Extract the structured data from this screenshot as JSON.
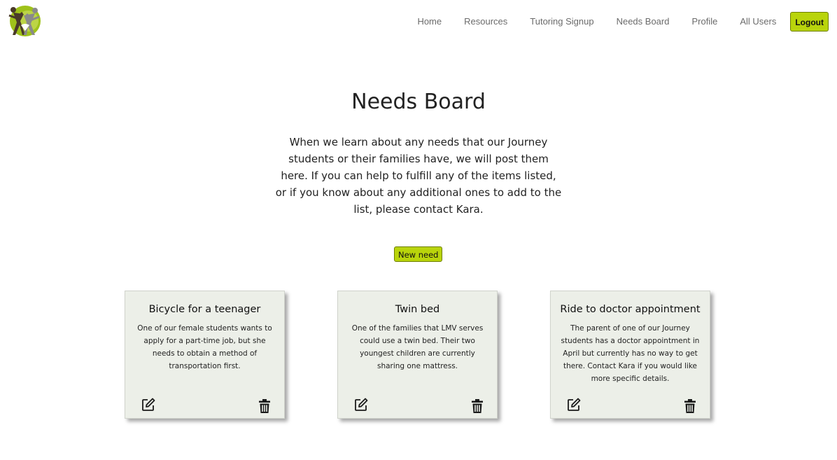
{
  "nav": {
    "items": [
      "Home",
      "Resources",
      "Tutoring Signup",
      "Needs Board",
      "Profile",
      "All Users"
    ],
    "logout_label": "Logout"
  },
  "page": {
    "title": "Needs Board",
    "intro": "When we learn about any needs that our Journey students or their families have, we will post them here. If you can help to fulfill any of the items listed, or if you know about any additional ones to add to the list, please contact Kara.",
    "new_need_label": "New need"
  },
  "needs": [
    {
      "title": "Bicycle for a teenager",
      "description": "One of our female students wants to apply for a part-time job, but she needs to obtain a method of transportation first."
    },
    {
      "title": "Twin bed",
      "description": "One of the families that LMV serves could use a twin bed. Their two youngest children are currently sharing one mattress."
    },
    {
      "title": "Ride to doctor appointment",
      "description": "The parent of one of our Journey students has a doctor appointment in April but currently has no way to get there. Contact Kara if you would like more specific details."
    }
  ],
  "colors": {
    "accent": "#b9d40b",
    "card_bg": "#ecefe8"
  },
  "icons": {
    "edit": "edit-icon",
    "delete": "trash-icon",
    "logo": "logo-icon"
  }
}
